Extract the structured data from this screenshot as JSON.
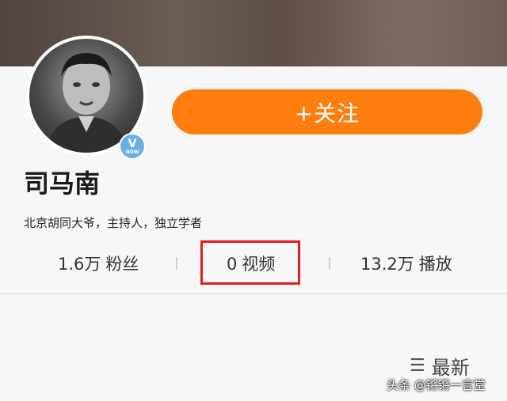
{
  "profile": {
    "name": "司马南",
    "bio": "北京胡同大爷，主持人，独立学者",
    "verified_badge_letter": "V",
    "verified_badge_text": "NOW"
  },
  "follow_button": {
    "label": "+关注"
  },
  "stats": [
    {
      "value": "1.6万",
      "label": "粉丝"
    },
    {
      "value": "0",
      "label": "视频"
    },
    {
      "value": "13.2万",
      "label": "播放"
    }
  ],
  "sort": {
    "icon": "sort-icon",
    "label": "最新"
  },
  "watermark": "头条 @锵锵一言堂",
  "colors": {
    "follow_button": "#fd7d0f",
    "highlight_box": "#e41c1c",
    "verify_badge": "#6ab0e8"
  }
}
